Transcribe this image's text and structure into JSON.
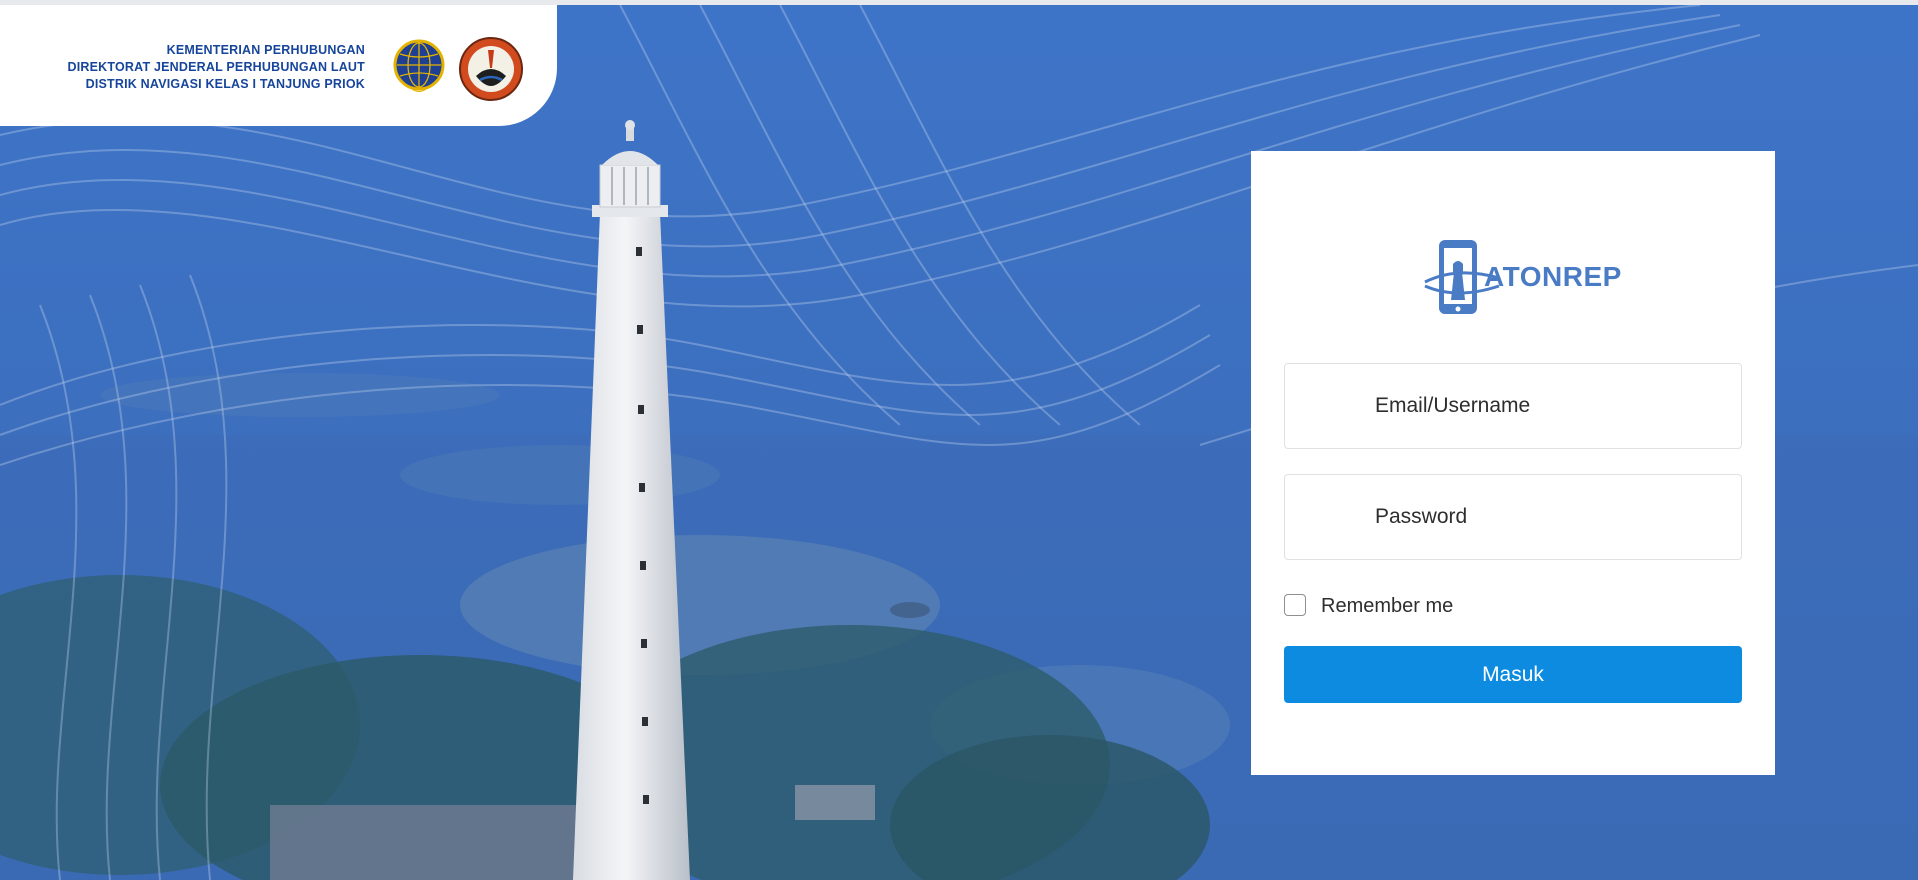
{
  "header": {
    "lines": [
      "KEMENTERIAN PERHUBUNGAN",
      "DIREKTORAT JENDERAL PERHUBUNGAN LAUT",
      "DISTRIK NAVIGASI KELAS I TANJUNG PRIOK"
    ],
    "logos": [
      "kemenhub-emblem-icon",
      "distrik-navigasi-emblem-icon"
    ]
  },
  "login": {
    "app_name": "ATONREP",
    "app_logo_icon": "smartphone-lighthouse-icon",
    "email_placeholder": "Email/Username",
    "password_placeholder": "Password",
    "remember_label": "Remember me",
    "remember_checked": false,
    "submit_label": "Masuk"
  },
  "colors": {
    "background": "#3f73c4",
    "brand_text": "#16459b",
    "app_logo": "#4a7cc6",
    "button": "#0c8be0"
  }
}
